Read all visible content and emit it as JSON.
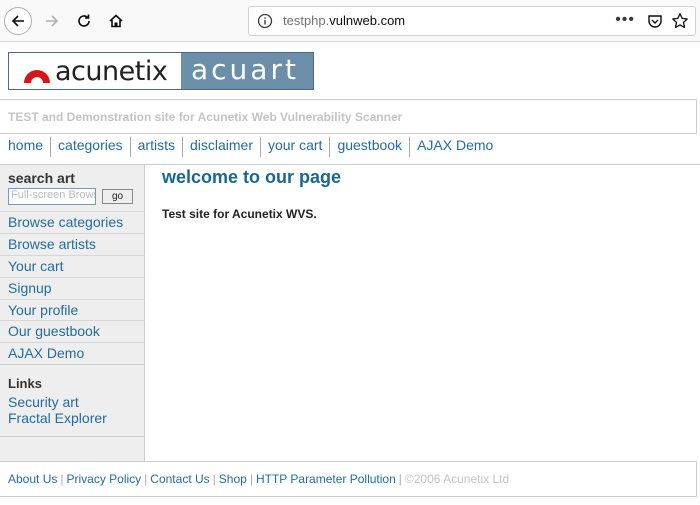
{
  "browser": {
    "url_prefix": "testphp.",
    "url_host": "vulnweb.com",
    "menu_dots": "•••"
  },
  "logo": {
    "brand": "acunetix",
    "product": "acuart"
  },
  "header": {
    "tagline": "TEST and Demonstration site for Acunetix Web Vulnerability Scanner"
  },
  "nav": {
    "items": [
      "home",
      "categories",
      "artists",
      "disclaimer",
      "your cart",
      "guestbook",
      "AJAX Demo"
    ]
  },
  "sidebar": {
    "search_title": "search art",
    "search_placeholder": "Full-screen Browsing",
    "go_label": "go",
    "items": [
      "Browse categories",
      "Browse artists",
      "Your cart",
      "Signup",
      "Your profile",
      "Our guestbook",
      "AJAX Demo"
    ],
    "links_title": "Links",
    "links": [
      "Security art",
      "Fractal Explorer"
    ]
  },
  "main": {
    "title": "welcome to our page",
    "text": "Test site for Acunetix WVS."
  },
  "footer": {
    "links": [
      "About Us",
      "Privacy Policy",
      "Contact Us",
      "Shop",
      "HTTP Parameter Pollution"
    ],
    "copyright": "©2006 Acunetix Ltd"
  },
  "colors": {
    "link": "#246c9c",
    "heading": "#1b6790",
    "acuart_bg": "#6b8fa8"
  }
}
